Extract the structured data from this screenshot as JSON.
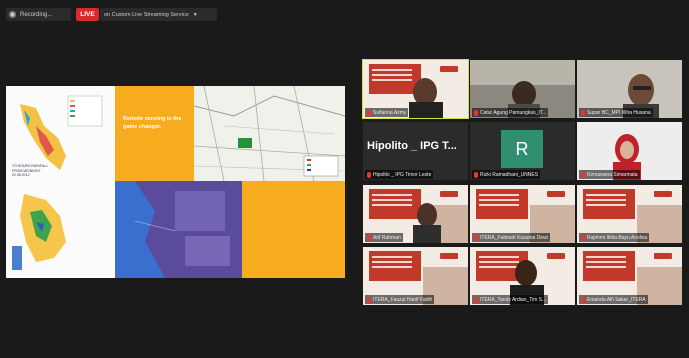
{
  "topbar": {
    "recording_label": "Recording...",
    "live_label": "LIVE",
    "stream_label": "on Custom Live Streaming Service"
  },
  "shared_screen": {
    "map_left_title": "Rainfall map",
    "orange_text": "Remote sensing is the game changer.",
    "caption_1": "TO HOURS RAINFALL",
    "caption_2": "FROM MIDNIGHT 02.08.2012"
  },
  "participants": [
    {
      "name": "Sufianna Azmy",
      "type": "camera-slide",
      "active": true
    },
    {
      "name": "Catur Agung Pamungkas_IT...",
      "type": "camera"
    },
    {
      "name": "Supar BC_MPI Wira Husana",
      "type": "camera"
    },
    {
      "name": "Hipolito _ IPG Timor Leste",
      "type": "text",
      "display": "Hipolito _ IPG T..."
    },
    {
      "name": "Rizki Ramadhani_UNNES",
      "type": "avatar",
      "initial": "R"
    },
    {
      "name": "Kirmawana Simarmata",
      "type": "camera-hijab"
    },
    {
      "name": "Arif Rahman",
      "type": "camera-slide"
    },
    {
      "name": "ITERA_Fatimah Kusuma Dewi",
      "type": "slide"
    },
    {
      "name": "Rajimmi Ikhla Bayu Anolisa",
      "type": "slide"
    },
    {
      "name": "ITERA_Fauzul Hanif Fadhl",
      "type": "slide"
    },
    {
      "name": "ITERA_Tandy Ardian_Tim S...",
      "type": "camera-slide"
    },
    {
      "name": "Emanda Alfi Sakar_ITERA",
      "type": "slide"
    }
  ]
}
